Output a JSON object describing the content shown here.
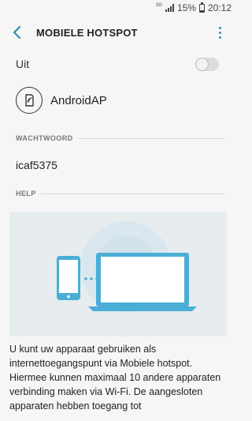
{
  "status_bar": {
    "network": "3G",
    "battery": "15%",
    "time": "20:12"
  },
  "header": {
    "title": "MOBIELE HOTSPOT",
    "back_icon": "back-arrow-icon",
    "menu_icon": "more-vert-icon"
  },
  "toggle_row": {
    "label": "Uit",
    "state": "off"
  },
  "hotspot": {
    "name": "AndroidAP",
    "icon": "hotspot-phone-icon"
  },
  "password_section": {
    "label": "WACHTWOORD",
    "value": "icaf5375"
  },
  "help_section": {
    "label": "HELP",
    "text": "U kunt uw apparaat gebruiken als internettoegangspunt via Mobiele hotspot. Hiermee kunnen maximaal 10 andere apparaten verbinding maken via Wi-Fi. De aangesloten apparaten hebben toegang tot"
  },
  "colors": {
    "accent": "#2f8fb0",
    "illustration_blue": "#4aaed6",
    "illustration_bg": "#e7ecef"
  }
}
